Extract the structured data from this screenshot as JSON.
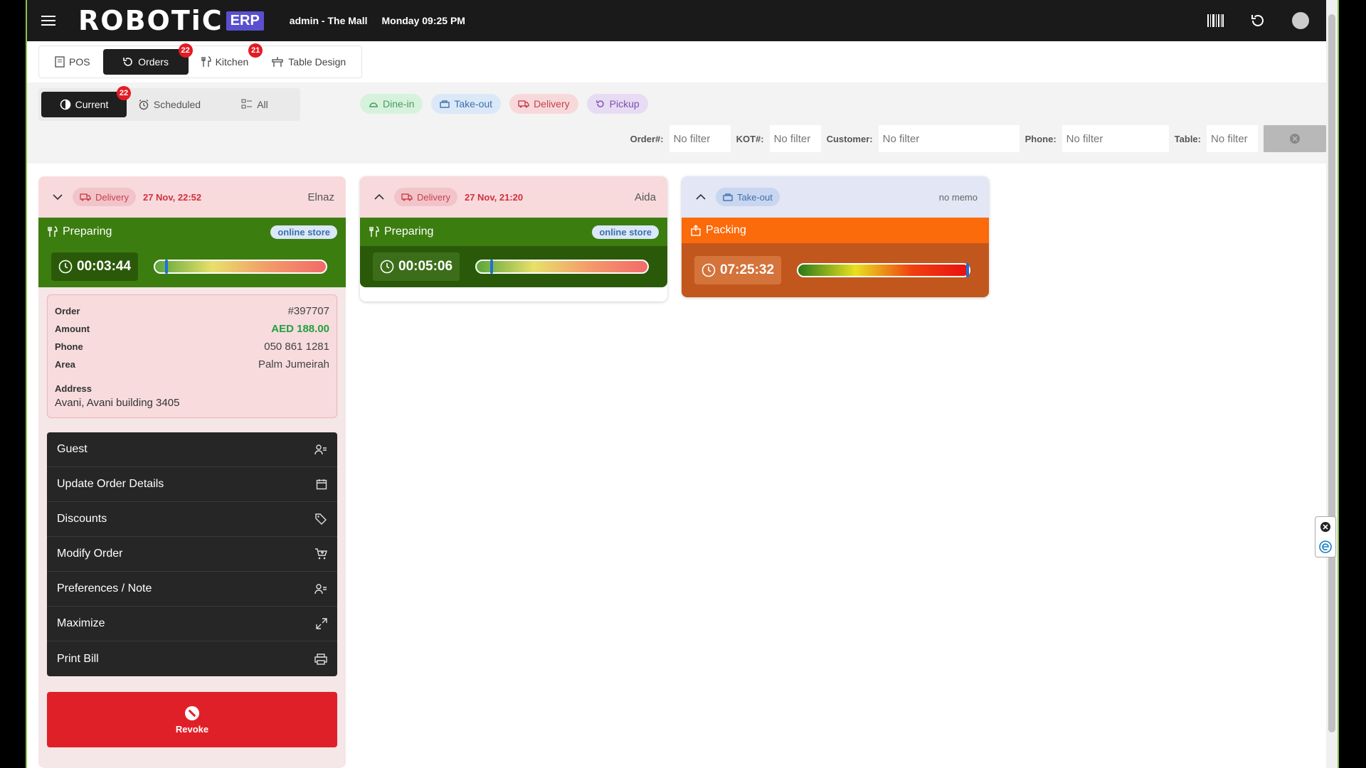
{
  "topbar": {
    "logo_text": "ROBOTiC",
    "logo_badge": "ERP",
    "user": "admin - The Mall",
    "datetime": "Monday 09:25 PM"
  },
  "nav": {
    "tabs": [
      {
        "label": "POS",
        "icon": "pos-icon"
      },
      {
        "label": "Orders",
        "icon": "orders-icon",
        "badge": "22",
        "active": true
      },
      {
        "label": "Kitchen",
        "icon": "kitchen-icon",
        "badge": "21"
      },
      {
        "label": "Table Design",
        "icon": "table-design-icon"
      }
    ]
  },
  "view_tabs": [
    {
      "label": "Current",
      "badge": "22",
      "active": true
    },
    {
      "label": "Scheduled"
    },
    {
      "label": "All"
    }
  ],
  "type_filters": [
    "Dine-in",
    "Take-out",
    "Delivery",
    "Pickup"
  ],
  "search": {
    "order_label": "Order#:",
    "order_placeholder": "No filter",
    "kot_label": "KOT#:",
    "kot_placeholder": "No filter",
    "customer_label": "Customer:",
    "customer_placeholder": "No filter",
    "phone_label": "Phone:",
    "phone_placeholder": "No filter",
    "table_label": "Table:",
    "table_placeholder": "No filter"
  },
  "cards": [
    {
      "type": "Delivery",
      "time": "27 Nov, 22:52",
      "name": "Elnaz",
      "status": "Preparing",
      "source": "online store",
      "timer": "00:03:44",
      "progress": 0.06,
      "details": {
        "order_label": "Order",
        "order": "#397707",
        "amount_label": "Amount",
        "amount": "AED 188.00",
        "phone_label": "Phone",
        "phone": "050 861 1281",
        "area_label": "Area",
        "area": "Palm Jumeirah",
        "address_label": "Address",
        "address": "Avani, Avani building 3405"
      },
      "actions": [
        "Guest",
        "Update Order Details",
        "Discounts",
        "Modify Order",
        "Preferences / Note",
        "Maximize",
        "Print Bill"
      ],
      "revoke_label": "Revoke"
    },
    {
      "type": "Delivery",
      "time": "27 Nov, 21:20",
      "name": "Aida",
      "status": "Preparing",
      "source": "online store",
      "timer": "00:05:06",
      "progress": 0.08
    },
    {
      "type": "Take-out",
      "memo": "no memo",
      "status": "Packing",
      "timer": "07:25:32",
      "progress": 1.0
    }
  ],
  "colors": {
    "preparing": "#3c7d10",
    "preparing_dark": "#2a5a09",
    "packing": "#fb6a0b",
    "packing_dark": "#c2571e",
    "delivery_head": "#f8dadd",
    "takeout_head": "#e2e6f5",
    "revoke": "#e02028"
  }
}
